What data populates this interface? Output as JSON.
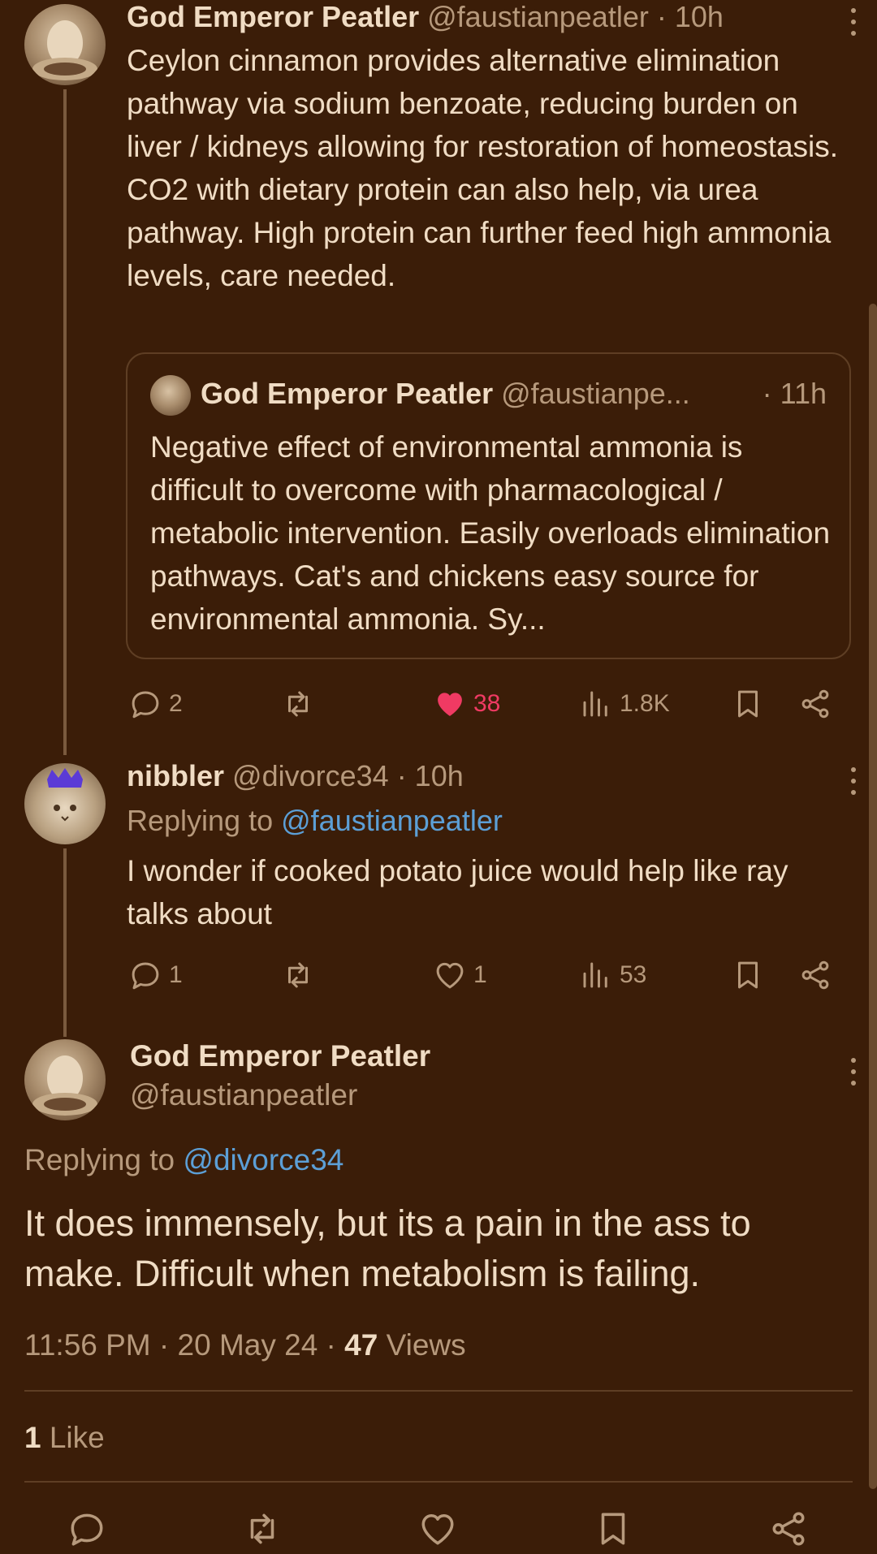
{
  "tweets": [
    {
      "name": "God Emperor Peatler",
      "handle": "@faustianpeatler",
      "time": "· 10h",
      "body": "Ceylon cinnamon provides alternative elimination pathway via sodium benzoate, reducing burden on liver / kidneys allowing for restoration of homeostasis. CO2 with dietary protein can also help, via urea pathway. High protein can further feed high ammonia levels, care needed.",
      "quote": {
        "name": "God Emperor Peatler",
        "handle": "@faustianpe...",
        "time": "· 11h",
        "body": "Negative effect of environmental ammonia is difficult to overcome with pharmacological / metabolic intervention. Easily overloads elimination pathways. Cat's and chickens easy source for environmental ammonia. Sy..."
      },
      "replies": "2",
      "likes": "38",
      "views": "1.8K"
    },
    {
      "name": "nibbler",
      "handle": "@divorce34",
      "time": "· 10h",
      "replying_prefix": "Replying to",
      "replying_to": "@faustianpeatler",
      "body": "I wonder if cooked potato juice would help like ray talks about",
      "replies": "1",
      "likes": "1",
      "views": "53"
    }
  ],
  "main_tweet": {
    "name": "God Emperor Peatler",
    "handle": "@faustianpeatler",
    "replying_prefix": "Replying to",
    "replying_to": "@divorce34",
    "body": "It does immensely, but its a pain in the ass to make. Difficult when metabolism is failing.",
    "timestamp": "11:56 PM · 20 May 24 · ",
    "views_count": "47",
    "views_label": " Views",
    "likes_count": "1",
    "likes_label": " Like"
  },
  "colors": {
    "background": "#3b1d08",
    "text": "#f0dcc4",
    "muted": "#b6997c",
    "link": "#5c9fd6",
    "like": "#f03a63"
  }
}
